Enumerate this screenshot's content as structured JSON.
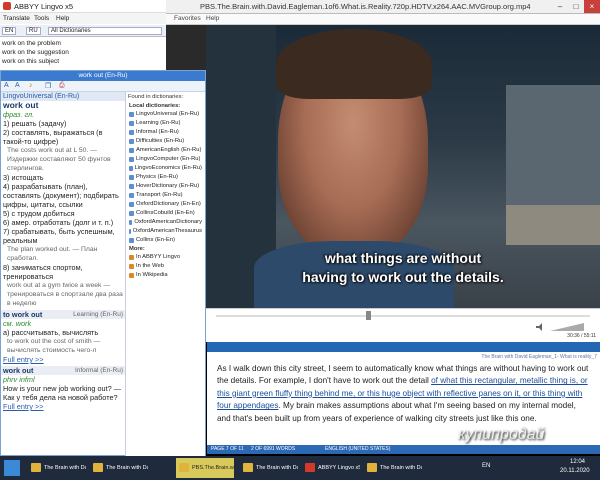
{
  "player": {
    "title": "PBS.The.Brain.with.David.Eagleman.1of6.What.is.Reality.720p.HDTV.x264.AAC.MVGroup.org.mp4",
    "menu": [
      "Favorites",
      "Help"
    ],
    "subtitle_line1": "what things are without",
    "subtitle_line2": "having to work out the details.",
    "time": "30:36 / 55:11"
  },
  "abbyy": {
    "title": "ABBYY Lingvo x5",
    "menu": [
      "Translate",
      "Tools",
      "Help"
    ],
    "lang_from": "EN",
    "lang_to": "RU",
    "dict_select": "All Dictionaries",
    "list": [
      "work on the problem",
      "work on the suggestion",
      "work on this subject"
    ]
  },
  "card": {
    "title": "work out (En-Ru)",
    "dict_header": "LingvoUniversal (En-Ru)",
    "headword": "work out",
    "grammar": "фраз. гл.",
    "lines": [
      {
        "t": "1) решать (задачу)",
        "c": "ln"
      },
      {
        "t": "2) составлять, выражаться (в такой-то цифре)",
        "c": "ln"
      },
      {
        "t": "The costs work out at L 50. — Издержки составляют 50 фунтов стерлингов.",
        "c": "ex"
      },
      {
        "t": "3) истощать",
        "c": "ln"
      },
      {
        "t": "4) разрабатывать (план), составлять (документ); подбирать цифры, цитаты, ссылки",
        "c": "ln"
      },
      {
        "t": "5) с трудом добиться",
        "c": "ln"
      },
      {
        "t": "6) амер. отработать (долг и т. п.)",
        "c": "ln"
      },
      {
        "t": "7) срабатывать, быть успешным, реальным",
        "c": "ln"
      },
      {
        "t": "The plan worked out. — План сработал.",
        "c": "ex"
      },
      {
        "t": "8) заниматься спортом, тренироваться",
        "c": "ln"
      },
      {
        "t": "work out at a gym twice a week — тренироваться в спортзале два раза в неделю",
        "c": "ex"
      }
    ],
    "section2": {
      "head": "to work out",
      "dict": "Learning (En-Ru)",
      "grammar": "см. work",
      "line": "а) рассчитывать, вычислять",
      "example": "to work out the cost of smith — вычислять стоимость чего-л",
      "link": "Full entry >>"
    },
    "section3": {
      "head": "work out",
      "dict": "Informal (En-Ru)",
      "grammar": "phrv infml",
      "line": "How is your new job working out? — Как у тебя дела на новой работе?",
      "link": "Full entry >>"
    },
    "found_header": "Found in dictionaries:",
    "local_header": "Local dictionaries:",
    "dicts": [
      "LingvoUniversal (En-Ru)",
      "Learning (En-Ru)",
      "Informal (En-Ru)",
      "Difficulties (En-Ru)",
      "AmericanEnglish (En-Ru)",
      "LingvoComputer (En-Ru)",
      "LingvoEconomics (En-Ru)",
      "Physics (En-Ru)",
      "HoverDictionary (En-Ru)",
      "Transport (En-Ru)",
      "OxfordDictionary (En-En)",
      "CollinsCobuild (En-En)",
      "OxfordAmericanDictionary",
      "OxfordAmericanThesaurus",
      "Collins (En-En)"
    ],
    "more_header": "More:",
    "more": [
      "In ABBYY Lingvo",
      "In the Web",
      "In Wikipedia"
    ]
  },
  "doc": {
    "title": "The Brain with David Eagleman_1- What is reality_7",
    "para_a": "As I walk down this city street, I seem to automatically know what things are without having to work out the details. For example, I don't have to work out the detail ",
    "para_u": "of what this rectangular, metallic thing is, or this giant green fluffy thing behind me, or this huge object with reflective panes on it, or this thing with four appendages",
    "para_b": ". My brain makes assumptions about what I'm seeing based on my internal model, and that's been built up from years of experience of walking city streets just like this one.",
    "status_page": "PAGE 7 OF 11",
    "status_words": "2 OF 6991 WORDS",
    "status_lang": "ENGLISH (UNITED STATES)"
  },
  "taskbar": {
    "items": [
      "The Brain with Da...",
      "The Brain with Da...",
      "PBS.The.Brain.wit...",
      "The Brain with Da...",
      "ABBYY Lingvo x5",
      "The Brain with Da..."
    ],
    "lang": "EN",
    "time": "12:04",
    "date": "20.11.2020"
  },
  "watermark": "купипродай"
}
